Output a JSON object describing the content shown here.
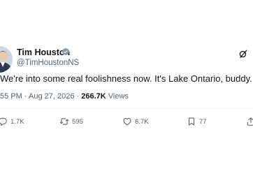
{
  "author": {
    "name": "Tim Houston",
    "handle": "@TimHoustonNS"
  },
  "tweet": {
    "text": "We're into some real foolishness now. It's Lake Ontario, buddy.",
    "time": "55 PM",
    "date": "Aug 27, 2026",
    "separator": "·",
    "views_count": "266.7K",
    "views_label": "Views"
  },
  "actions": {
    "replies": "1.7K",
    "reposts": "595",
    "likes": "6.7K",
    "bookmarks": "77"
  },
  "icons": {
    "verified": "verified-badge-icon",
    "grok": "grok-icon",
    "reply": "reply-icon",
    "repost": "repost-icon",
    "like": "heart-icon",
    "bookmark": "bookmark-icon",
    "share": "share-icon"
  },
  "colors": {
    "text": "#0f1419",
    "secondary": "#536471",
    "verified_badge": "#829aab"
  }
}
